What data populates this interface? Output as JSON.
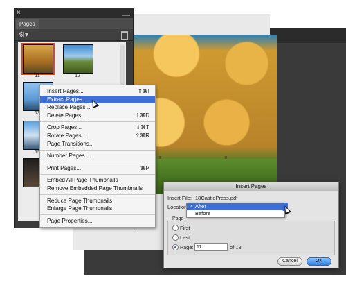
{
  "panel": {
    "title": "Pages",
    "close_glyph": "×",
    "options_icon": "gear-icon",
    "trash_icon": "trash-icon"
  },
  "thumbnails": [
    {
      "number": "11",
      "selected": true
    },
    {
      "number": "12",
      "selected": false
    },
    {
      "number": "13",
      "selected": false
    },
    {
      "number": "15",
      "selected": false
    }
  ],
  "context_menu": {
    "items": [
      {
        "label": "Insert Pages...",
        "shortcut": "⇧⌘I",
        "highlighted": false
      },
      {
        "label": "Extract Pages...",
        "shortcut": "",
        "highlighted": true
      },
      {
        "label": "Replace Pages...",
        "shortcut": "",
        "highlighted": false
      },
      {
        "label": "Delete Pages...",
        "shortcut": "⇧⌘D",
        "highlighted": false
      },
      {
        "label": "Crop Pages...",
        "shortcut": "⇧⌘T",
        "highlighted": false
      },
      {
        "label": "Rotate Pages...",
        "shortcut": "⇧⌘R",
        "highlighted": false
      },
      {
        "label": "Page Transitions...",
        "shortcut": "",
        "highlighted": false
      },
      {
        "label": "Number Pages...",
        "shortcut": "",
        "highlighted": false
      },
      {
        "label": "Print Pages...",
        "shortcut": "⌘P",
        "highlighted": false
      },
      {
        "label": "Embed All Page Thumbnails",
        "shortcut": "",
        "highlighted": false
      },
      {
        "label": "Remove Embedded Page Thumbnails",
        "shortcut": "",
        "highlighted": false
      },
      {
        "label": "Reduce Page Thumbnails",
        "shortcut": "",
        "highlighted": false
      },
      {
        "label": "Enlarge Page Thumbnails",
        "shortcut": "",
        "highlighted": false
      },
      {
        "label": "Page Properties...",
        "shortcut": "",
        "highlighted": false
      }
    ]
  },
  "dialog": {
    "title": "Insert Pages",
    "insert_file_label": "Insert File:",
    "insert_file_value": "18CastlePress.pdf",
    "location_label": "Location",
    "location_options": [
      "After",
      "Before"
    ],
    "location_selected": "After",
    "location_check": "✓",
    "page_group_label": "Page",
    "first_label": "First",
    "last_label": "Last",
    "page_label": "Page:",
    "page_value": "11",
    "of_text": "of 18",
    "cancel_label": "Cancel",
    "ok_label": "OK"
  }
}
